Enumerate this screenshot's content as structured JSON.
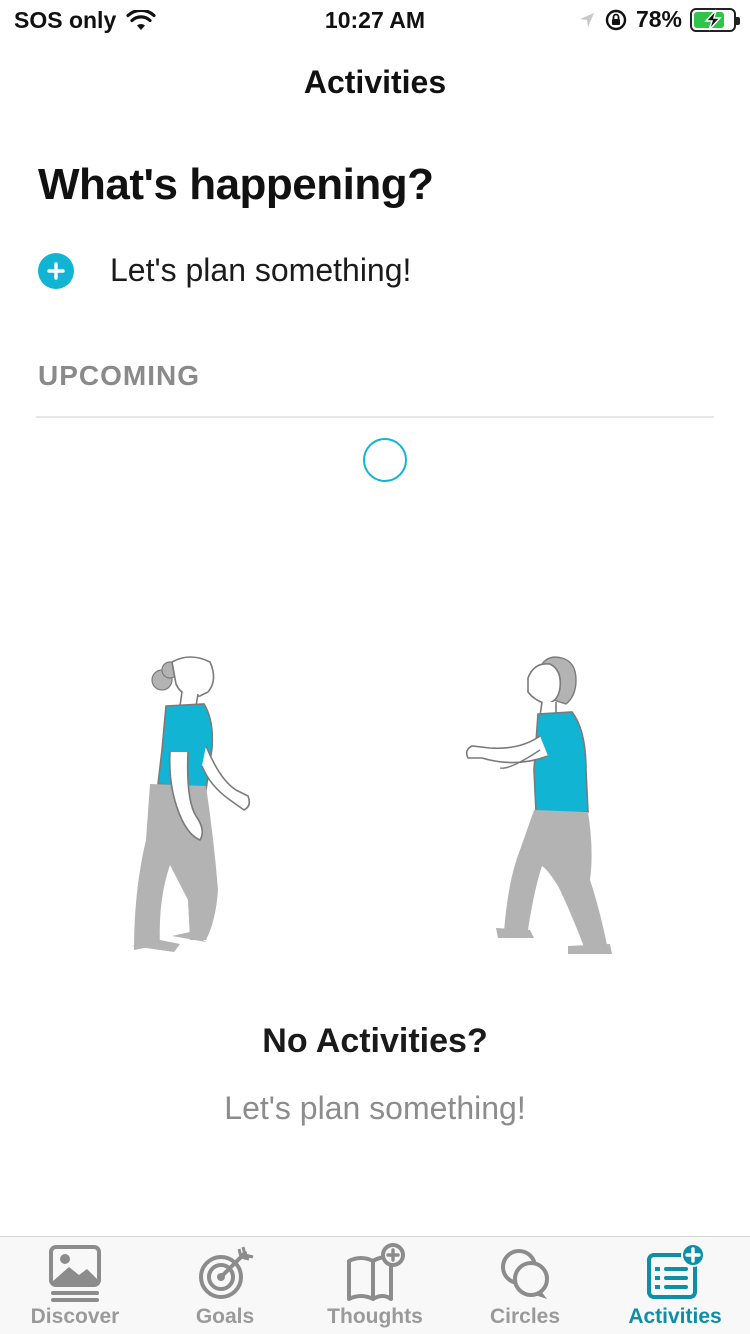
{
  "status_bar": {
    "carrier": "SOS only",
    "time": "10:27 AM",
    "battery": "78%",
    "battery_level": 0.78
  },
  "nav": {
    "title": "Activities"
  },
  "main": {
    "heading": "What's happening?",
    "plan_label": "Let's plan something!",
    "section_label": "UPCOMING",
    "empty_title": "No Activities?",
    "empty_subtitle": "Let's plan something!"
  },
  "tabs": [
    {
      "label": "Discover",
      "icon": "image-icon"
    },
    {
      "label": "Goals",
      "icon": "target-icon"
    },
    {
      "label": "Thoughts",
      "icon": "book-plus-icon"
    },
    {
      "label": "Circles",
      "icon": "chat-bubbles-icon"
    },
    {
      "label": "Activities",
      "icon": "activities-list-icon",
      "active": true
    }
  ],
  "colors": {
    "accent": "#12b4d3",
    "active_tab": "#0d8fa8",
    "muted": "#8a8a8a"
  }
}
